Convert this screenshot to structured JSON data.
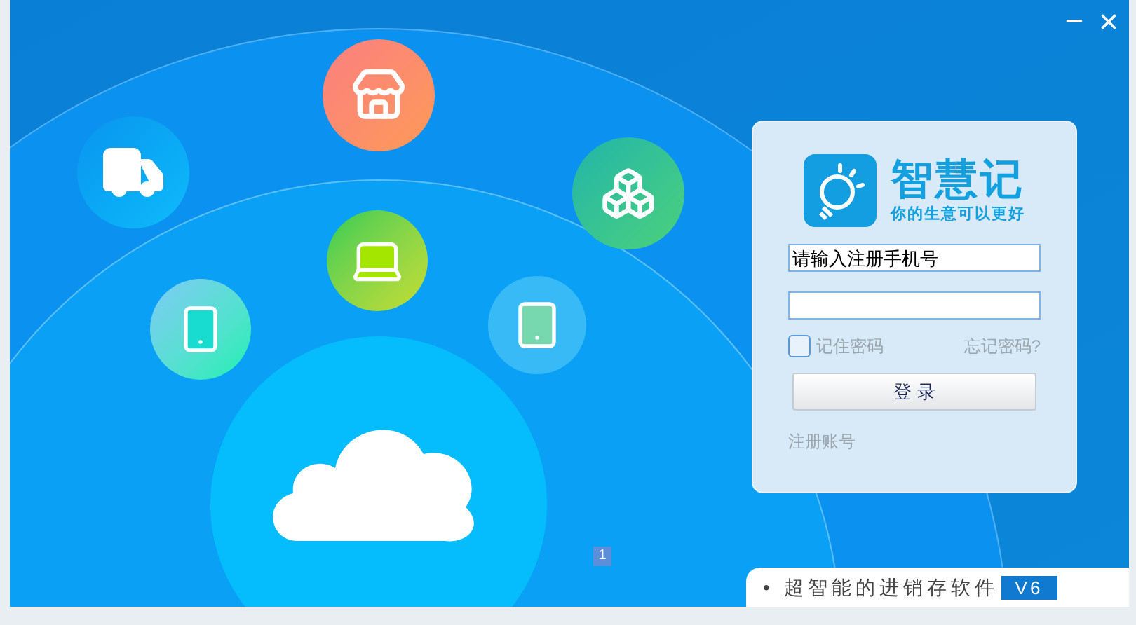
{
  "brand": {
    "name": "智慧记",
    "slogan": "你的生意可以更好"
  },
  "login": {
    "phone": {
      "placeholder": "请输入注册手机号"
    },
    "remember": {
      "label": "记住密码",
      "checked": false
    },
    "forgot": "忘记密码?",
    "submit": "登 录",
    "register": "注册账号"
  },
  "banner": {
    "text": "• 超智能的进销存软件",
    "version": "V6"
  },
  "page_indicator": "1"
}
